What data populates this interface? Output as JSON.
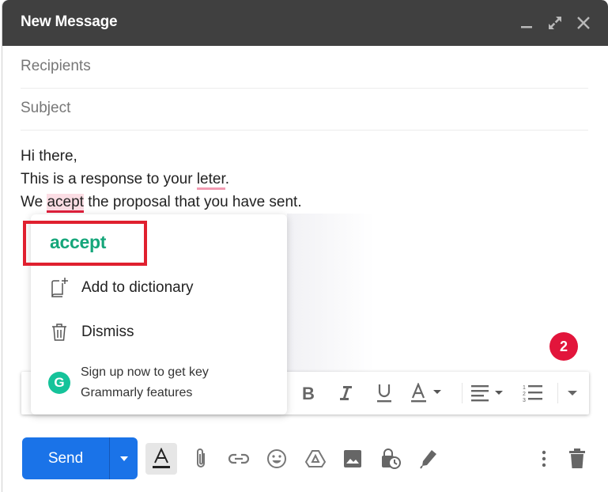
{
  "window": {
    "title": "New Message",
    "controls": {
      "minimize": "minimize-icon",
      "expand": "expand-icon",
      "close": "close-icon"
    }
  },
  "fields": {
    "recipients_placeholder": "Recipients",
    "recipients_value": "",
    "subject_placeholder": "Subject",
    "subject_value": ""
  },
  "body": {
    "line1": "Hi there,",
    "line2_before": "This is a response to your ",
    "line2_error": "leter",
    "line2_after": ".",
    "line3_before": "We ",
    "line3_error": "acept",
    "line3_after": " the proposal that you have sent."
  },
  "grammarly_popup": {
    "suggestion": "accept",
    "add_to_dictionary": "Add to dictionary",
    "dismiss": "Dismiss",
    "promo_line1": "Sign up now to get key",
    "promo_line2": "Grammarly features",
    "logo_letter": "G"
  },
  "badge": {
    "count": "2",
    "color": "#e2153b"
  },
  "formatting_toolbar": {
    "items": [
      "bold",
      "italic",
      "underline",
      "text-color",
      "align",
      "numbered-list",
      "more-formatting"
    ]
  },
  "bottom_toolbar": {
    "send_label": "Send",
    "accent_color": "#1a73e8",
    "tools": [
      "formatting-options",
      "attach-files",
      "insert-link",
      "insert-emoji",
      "insert-drive",
      "insert-photo",
      "confidential-mode",
      "insert-signature",
      "more-options",
      "discard-draft"
    ]
  },
  "colors": {
    "titlebar": "#404040",
    "grammarly_green": "#15a67a",
    "highlight_box": "#e0202f"
  }
}
